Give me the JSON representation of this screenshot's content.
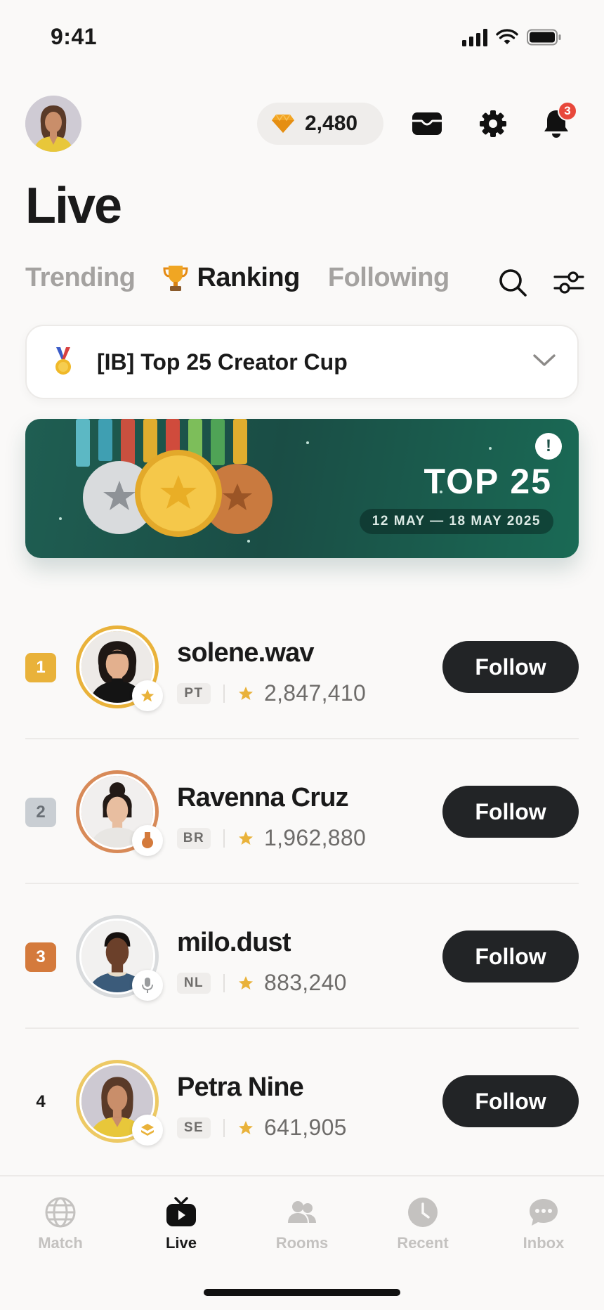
{
  "status_bar": {
    "time": "9:41"
  },
  "header": {
    "gems": "2,480",
    "notification_count": "3"
  },
  "page_title": "Live",
  "tabs": [
    {
      "label": "Trending"
    },
    {
      "label": "Ranking",
      "icon": "trophy-icon"
    },
    {
      "label": "Following"
    }
  ],
  "cup_selector": {
    "label": "[IB] Top 25 Creator Cup"
  },
  "banner": {
    "title": "TOP 25",
    "dates": "12 MAY — 18 MAY 2025",
    "info": "!"
  },
  "colors": {
    "rank1": "#E9B23A",
    "rank2": "#C9CED3",
    "rank3": "#D47A3C",
    "banner": "#1F5E52",
    "follow_button": "#222426"
  },
  "leaderboard": [
    {
      "rank": "1",
      "name": "solene.wav",
      "country": "PT",
      "score": "2,847,410",
      "follow": "Follow",
      "badge": "star-icon"
    },
    {
      "rank": "2",
      "name": "Ravenna Cruz",
      "country": "BR",
      "score": "1,962,880",
      "follow": "Follow",
      "badge": "medal-icon"
    },
    {
      "rank": "3",
      "name": "milo.dust",
      "country": "NL",
      "score": "883,240",
      "follow": "Follow",
      "badge": "mic-icon"
    },
    {
      "rank": "4",
      "name": "Petra Nine",
      "country": "SE",
      "score": "641,905",
      "follow": "Follow",
      "badge": "layers-icon"
    }
  ],
  "bottom_nav": [
    {
      "label": "Match",
      "icon": "globe-icon"
    },
    {
      "label": "Live",
      "icon": "tv-icon"
    },
    {
      "label": "Rooms",
      "icon": "people-icon"
    },
    {
      "label": "Recent",
      "icon": "clock-icon"
    },
    {
      "label": "Inbox",
      "icon": "chat-icon"
    }
  ]
}
